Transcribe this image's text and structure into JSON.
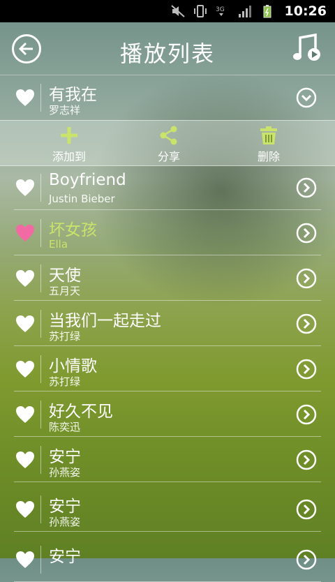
{
  "statusbar": {
    "time": "10:26",
    "network": "3G"
  },
  "header": {
    "title": "播放列表"
  },
  "actions": [
    {
      "label": "添加到",
      "icon": "plus-icon"
    },
    {
      "label": "分享",
      "icon": "share-icon"
    },
    {
      "label": "删除",
      "icon": "trash-icon"
    }
  ],
  "colors": {
    "accent": "#c9e36b",
    "favorite": "#f26aa3"
  },
  "songs": [
    {
      "title": "有我在",
      "artist": "罗志祥",
      "expanded": true
    },
    {
      "title": "Boyfriend",
      "artist": "Justin Bieber"
    },
    {
      "title": "坏女孩",
      "artist": "Ella",
      "active": true
    },
    {
      "title": "天使",
      "artist": "五月天"
    },
    {
      "title": "当我们一起走过",
      "artist": "苏打绿"
    },
    {
      "title": "小情歌",
      "artist": "苏打绿"
    },
    {
      "title": "好久不见",
      "artist": "陈奕迅"
    },
    {
      "title": "安宁",
      "artist": "孙燕姿"
    },
    {
      "title": "安宁",
      "artist": "孙燕姿"
    },
    {
      "title": "安宁",
      "artist": ""
    }
  ]
}
